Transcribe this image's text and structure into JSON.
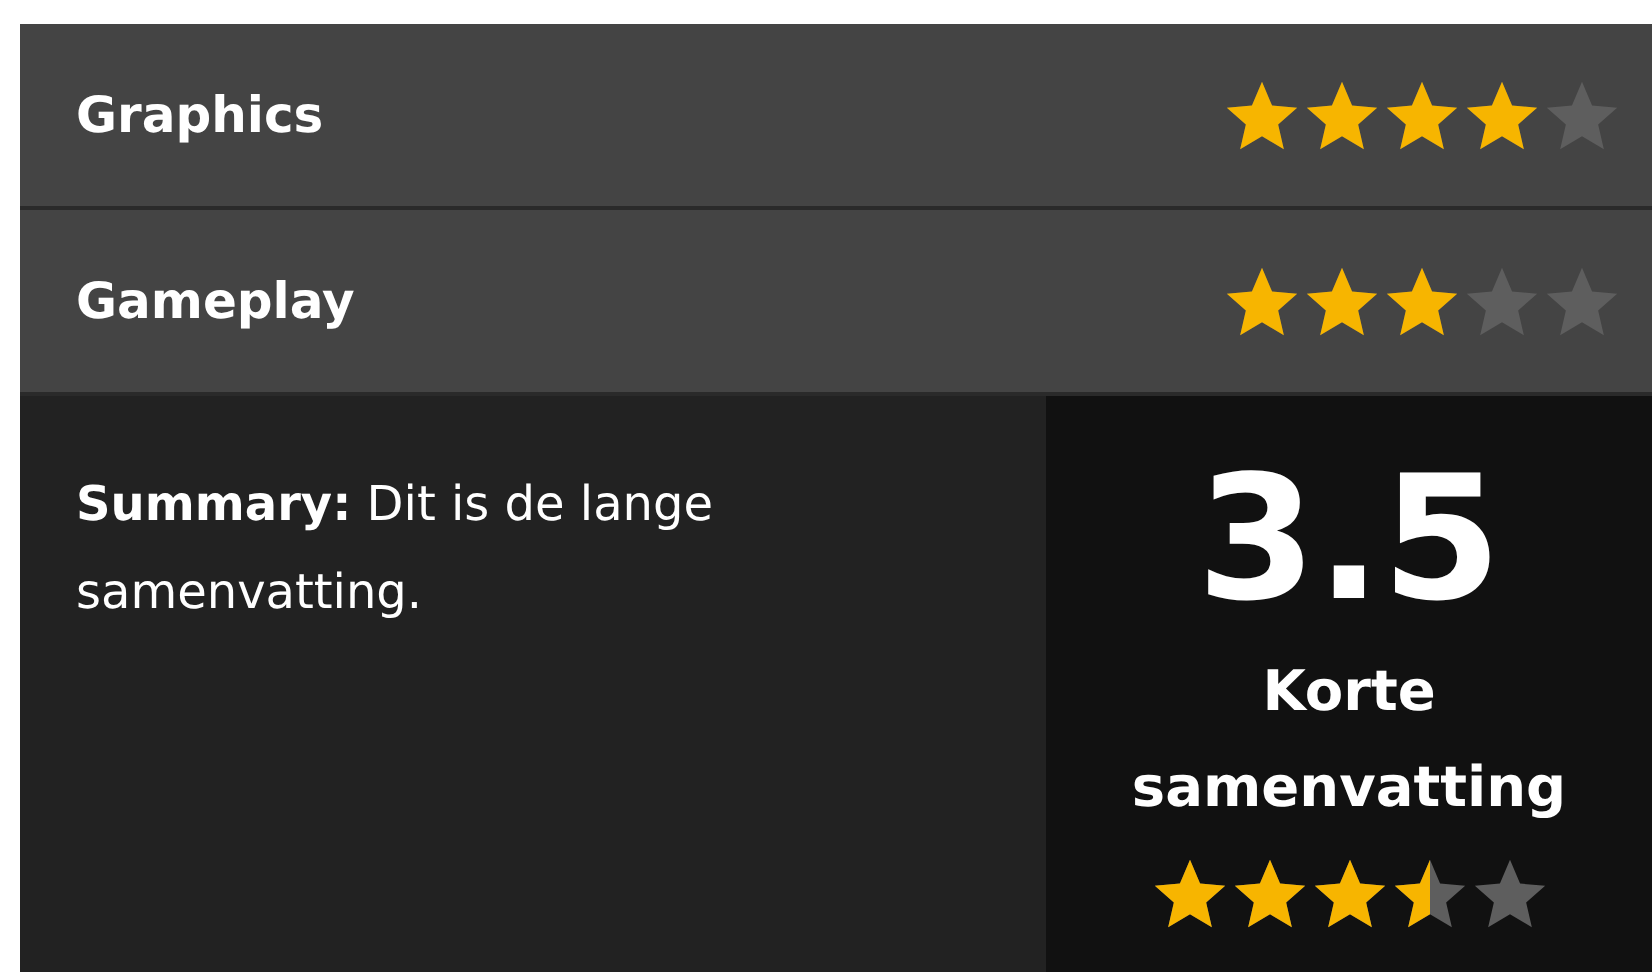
{
  "ratings": [
    {
      "label": "Graphics",
      "stars": 4
    },
    {
      "label": "Gameplay",
      "stars": 3
    }
  ],
  "summary": {
    "text": "**Summary:** Dit is de lange samenvatting."
  },
  "score": {
    "value": "3.5",
    "caption": "Korte samenvatting",
    "stars": 3.5
  }
}
